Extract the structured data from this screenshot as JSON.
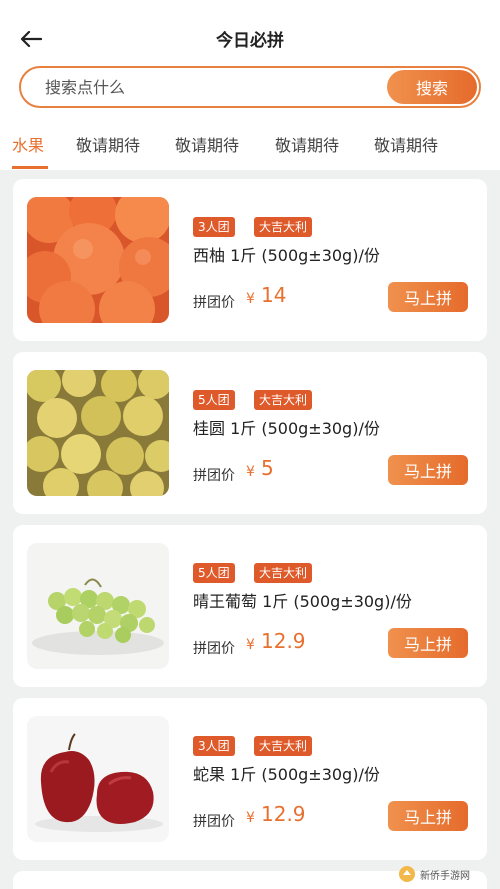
{
  "header": {
    "title": "今日必拼"
  },
  "search": {
    "placeholder": "搜索点什么",
    "button_label": "搜索"
  },
  "tabs": [
    {
      "label": "水果",
      "active": true
    },
    {
      "label": "敬请期待",
      "active": false
    },
    {
      "label": "敬请期待",
      "active": false
    },
    {
      "label": "敬请期待",
      "active": false
    },
    {
      "label": "敬请期待",
      "active": false
    }
  ],
  "products": [
    {
      "name": "西柚 1斤 (500g±30g)/份",
      "group_badge": "3人团",
      "tag_badge": "大吉大利",
      "price_label": "拼团价",
      "currency": "¥",
      "price": "14",
      "buy_label": "马上拼",
      "image_icon": "grapefruit-image"
    },
    {
      "name": "桂圆 1斤 (500g±30g)/份",
      "group_badge": "5人团",
      "tag_badge": "大吉大利",
      "price_label": "拼团价",
      "currency": "¥",
      "price": "5",
      "buy_label": "马上拼",
      "image_icon": "longan-image"
    },
    {
      "name": "晴王葡萄 1斤 (500g±30g)/份",
      "group_badge": "5人团",
      "tag_badge": "大吉大利",
      "price_label": "拼团价",
      "currency": "¥",
      "price": "12.9",
      "buy_label": "马上拼",
      "image_icon": "grape-image"
    },
    {
      "name": "蛇果 1斤 (500g±30g)/份",
      "group_badge": "3人团",
      "tag_badge": "大吉大利",
      "price_label": "拼团价",
      "currency": "¥",
      "price": "12.9",
      "buy_label": "马上拼",
      "image_icon": "red-apple-image"
    }
  ],
  "watermark": {
    "text": "新侨手游网"
  },
  "colors": {
    "accent": "#e8702f",
    "badge": "#df5a2a",
    "list_background": "#eef1ef"
  }
}
